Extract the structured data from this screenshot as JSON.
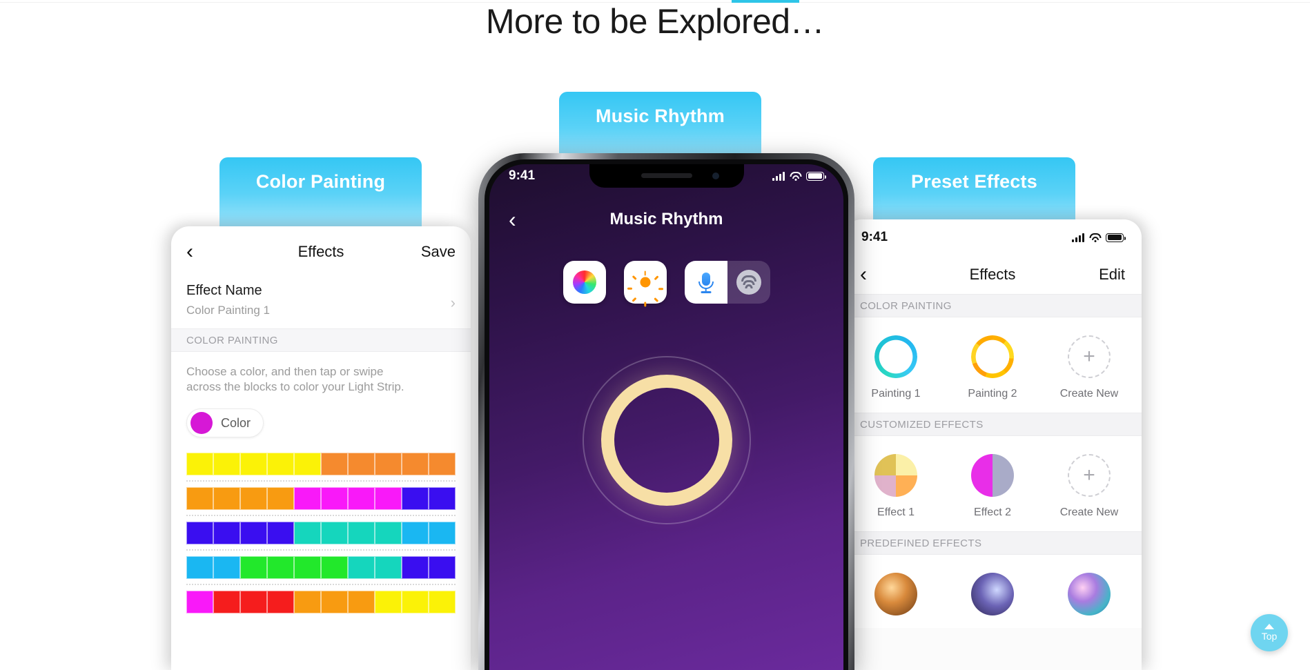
{
  "page": {
    "title": "More to be Explored…",
    "accent_color": "#2ec5e8"
  },
  "badges": [
    {
      "label": "Color Painting"
    },
    {
      "label": "Music Rhythm"
    },
    {
      "label": "Preset Effects"
    }
  ],
  "left_phone": {
    "nav": {
      "back_icon": "chevron-left-icon",
      "title": "Effects",
      "save_label": "Save"
    },
    "effect_name_row": {
      "label": "Effect Name",
      "value": "Color Painting 1",
      "chevron": "›"
    },
    "section_header": "COLOR PAINTING",
    "description": "Choose a color, and then tap or swipe across the blocks to color your Light Strip.",
    "color_chip": {
      "label": "Color",
      "swatch": "#d618d6"
    },
    "grid_rows": [
      [
        "#fbf207",
        "#fbf207",
        "#fbf207",
        "#fbf207",
        "#fbf207",
        "#f58a2e",
        "#f58a2e",
        "#f58a2e",
        "#f58a2e",
        "#f58a2e"
      ],
      [
        "#f89b11",
        "#f89b11",
        "#f89b11",
        "#f89b11",
        "#f919f9",
        "#f919f9",
        "#f919f9",
        "#f919f9",
        "#3a0ef0",
        "#3a0ef0"
      ],
      [
        "#3a0ef0",
        "#3a0ef0",
        "#3a0ef0",
        "#3a0ef0",
        "#15d6bd",
        "#15d6bd",
        "#15d6bd",
        "#15d6bd",
        "#1ab7f2",
        "#1ab7f2"
      ],
      [
        "#1ab7f2",
        "#1ab7f2",
        "#22e82b",
        "#22e82b",
        "#22e82b",
        "#22e82b",
        "#15d6bd",
        "#15d6bd",
        "#3a0ef0",
        "#3a0ef0"
      ],
      [
        "#f919f9",
        "#f51d1d",
        "#f51d1d",
        "#f51d1d",
        "#f89b11",
        "#f89b11",
        "#f89b11",
        "#fbf207",
        "#fbf207",
        "#fbf207"
      ]
    ]
  },
  "center_phone": {
    "status": {
      "time": "9:41",
      "signal_icon": "signal-bars-icon",
      "wifi_icon": "wifi-icon",
      "battery_icon": "battery-icon"
    },
    "nav": {
      "back_icon": "chevron-left-icon",
      "title": "Music Rhythm"
    },
    "mode_buttons": [
      {
        "name": "color-wheel-icon",
        "active": true
      },
      {
        "name": "brightness-sun-icon",
        "active": true
      },
      {
        "name": "microphone-icon",
        "active": true
      },
      {
        "name": "spotify-icon",
        "active": false
      }
    ],
    "visual": {
      "name": "rhythm-ring-visualizer",
      "ring_color": "#f7dfa6"
    }
  },
  "right_phone": {
    "status": {
      "time": "9:41",
      "signal_icon": "signal-bars-icon",
      "wifi_icon": "wifi-icon",
      "battery_icon": "battery-icon"
    },
    "nav": {
      "back_icon": "chevron-left-icon",
      "title": "Effects",
      "edit_label": "Edit"
    },
    "sections": [
      {
        "header": "COLOR PAINTING",
        "items": [
          {
            "label": "Painting 1",
            "thumb": "ring-teal"
          },
          {
            "label": "Painting 2",
            "thumb": "ring-orange"
          },
          {
            "label": "Create New",
            "thumb": "plus-dashed"
          }
        ]
      },
      {
        "header": "CUSTOMIZED EFFECTS",
        "items": [
          {
            "label": "Effect 1",
            "thumb": "disc-quad"
          },
          {
            "label": "Effect 2",
            "thumb": "disc-half"
          },
          {
            "label": "Create New",
            "thumb": "plus-dashed"
          }
        ]
      },
      {
        "header": "PREDEFINED EFFECTS",
        "items": [
          {
            "label": "",
            "thumb": "candle"
          },
          {
            "label": "",
            "thumb": "galaxy"
          },
          {
            "label": "",
            "thumb": "bubble"
          }
        ]
      }
    ]
  },
  "scroll_top_button": {
    "label": "Top",
    "icon": "triangle-up-icon",
    "color": "#6fd5f0"
  }
}
